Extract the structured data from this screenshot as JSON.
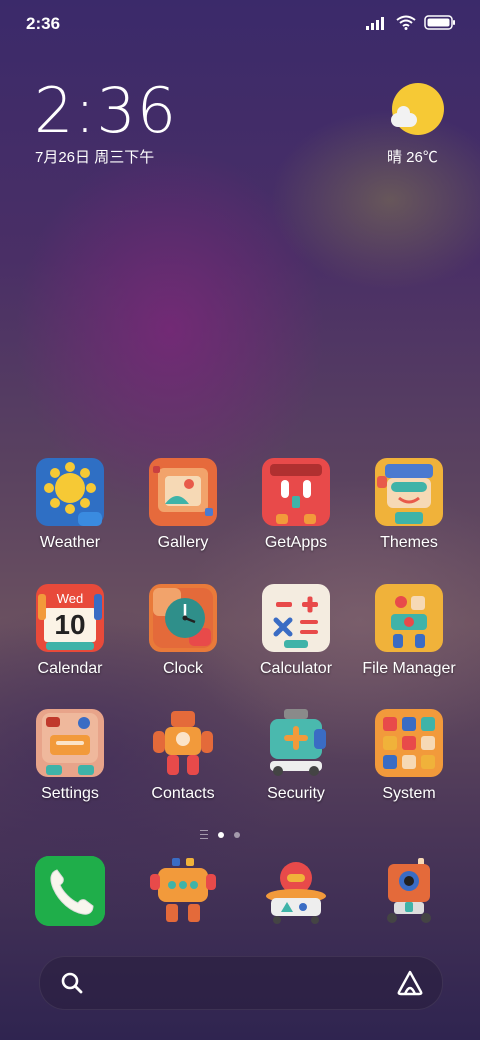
{
  "status_bar": {
    "time": "2:36"
  },
  "clock_widget": {
    "time": "2:36",
    "date": "7月26日 周三下午"
  },
  "weather_widget": {
    "text": "晴 26℃",
    "icon": "sun-cloud-icon"
  },
  "apps": [
    {
      "label": "Weather",
      "icon": "weather-icon"
    },
    {
      "label": "Gallery",
      "icon": "gallery-icon"
    },
    {
      "label": "GetApps",
      "icon": "getapps-icon"
    },
    {
      "label": "Themes",
      "icon": "themes-icon"
    },
    {
      "label": "Calendar",
      "icon": "calendar-icon",
      "badge_day": "Wed",
      "badge_date": "10"
    },
    {
      "label": "Clock",
      "icon": "clock-icon"
    },
    {
      "label": "Calculator",
      "icon": "calculator-icon"
    },
    {
      "label": "File Manager",
      "icon": "file-manager-icon"
    },
    {
      "label": "Settings",
      "icon": "settings-icon"
    },
    {
      "label": "Contacts",
      "icon": "contacts-icon"
    },
    {
      "label": "Security",
      "icon": "security-icon"
    },
    {
      "label": "System",
      "icon": "system-folder-icon"
    }
  ],
  "dock": [
    {
      "icon": "phone-icon"
    },
    {
      "icon": "messages-icon"
    },
    {
      "icon": "browser-icon"
    },
    {
      "icon": "camera-icon"
    }
  ],
  "colors": {
    "sun": "#f6c935",
    "phone_green": "#1fae4a"
  }
}
